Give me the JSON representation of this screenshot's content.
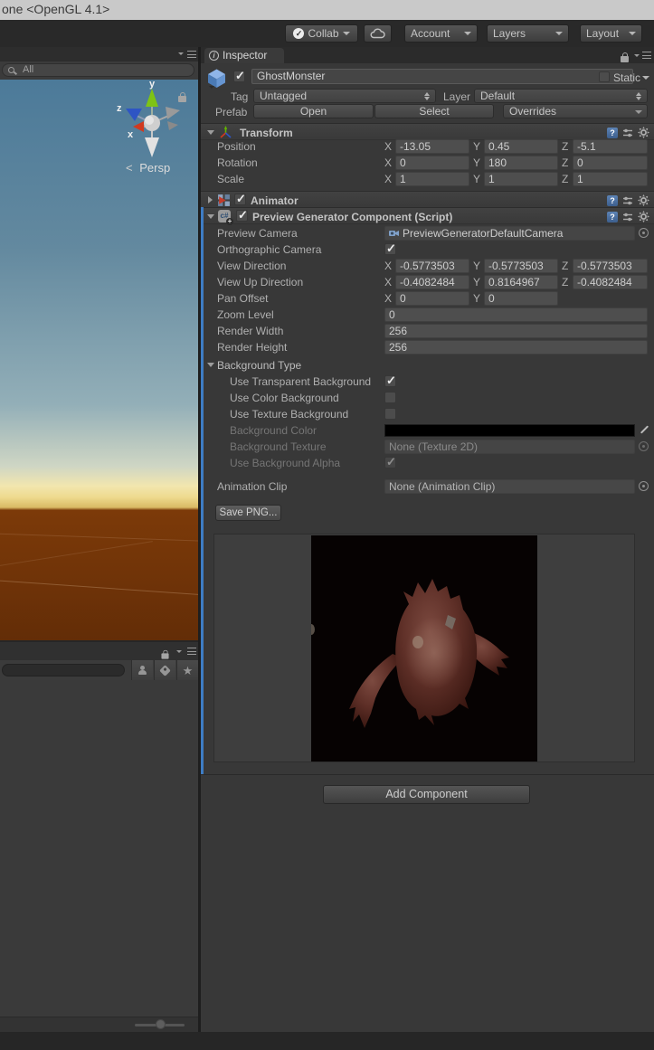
{
  "window": {
    "title": "one <OpenGL 4.1>"
  },
  "toolbar": {
    "collab_label": "Collab",
    "account_label": "Account",
    "layers_label": "Layers",
    "layout_label": "Layout"
  },
  "axes": {
    "x": "X",
    "y": "Y",
    "z": "Z"
  },
  "scene_panel": {
    "search_value": "All",
    "gizmo": {
      "x": "x",
      "y": "y",
      "z": "z",
      "persp_label": "Persp"
    }
  },
  "inspector": {
    "tab_label": "Inspector",
    "header": {
      "name": "GhostMonster",
      "enabled": true,
      "static_label": "Static",
      "static_checked": false,
      "tag_label": "Tag",
      "tag_value": "Untagged",
      "layer_label": "Layer",
      "layer_value": "Default",
      "prefab_label": "Prefab",
      "open_label": "Open",
      "select_label": "Select",
      "overrides_label": "Overrides"
    },
    "transform": {
      "title": "Transform",
      "position": {
        "label": "Position",
        "x": "-13.05",
        "y": "0.45",
        "z": "-5.1"
      },
      "rotation": {
        "label": "Rotation",
        "x": "0",
        "y": "180",
        "z": "0"
      },
      "scale": {
        "label": "Scale",
        "x": "1",
        "y": "1",
        "z": "1"
      }
    },
    "animator": {
      "title": "Animator",
      "enabled": true
    },
    "preview_generator": {
      "title": "Preview Generator Component (Script)",
      "enabled": true,
      "preview_camera": {
        "label": "Preview Camera",
        "value": "PreviewGeneratorDefaultCamera"
      },
      "orthographic_camera": {
        "label": "Orthographic Camera",
        "checked": true
      },
      "view_direction": {
        "label": "View Direction",
        "x": "-0.5773503",
        "y": "-0.5773503",
        "z": "-0.5773503"
      },
      "view_up_direction": {
        "label": "View Up Direction",
        "x": "-0.4082484",
        "y": "0.8164967",
        "z": "-0.4082484"
      },
      "pan_offset": {
        "label": "Pan Offset",
        "x": "0",
        "y": "0"
      },
      "zoom_level": {
        "label": "Zoom Level",
        "value": "0"
      },
      "render_width": {
        "label": "Render Width",
        "value": "256"
      },
      "render_height": {
        "label": "Render Height",
        "value": "256"
      },
      "background_type": {
        "label": "Background Type",
        "use_transparent_background": {
          "label": "Use Transparent Background",
          "checked": true
        },
        "use_color_background": {
          "label": "Use Color Background",
          "checked": false
        },
        "use_texture_background": {
          "label": "Use Texture Background",
          "checked": false
        },
        "background_color": {
          "label": "Background Color",
          "value_hex": "#000000"
        },
        "background_texture": {
          "label": "Background Texture",
          "value": "None (Texture 2D)"
        },
        "use_background_alpha": {
          "label": "Use Background Alpha",
          "checked": true
        }
      },
      "animation_clip": {
        "label": "Animation Clip",
        "value": "None (Animation Clip)"
      },
      "save_png_label": "Save PNG..."
    },
    "add_component_label": "Add Component"
  },
  "colors": {
    "override_blue": "#3e7cc4",
    "sky_top": "#4c7a99",
    "horizon_cream": "#f2e6ae",
    "ground_brown": "#7c3a09",
    "panel_bg": "#383838",
    "field_bg": "#4e4e4e"
  }
}
